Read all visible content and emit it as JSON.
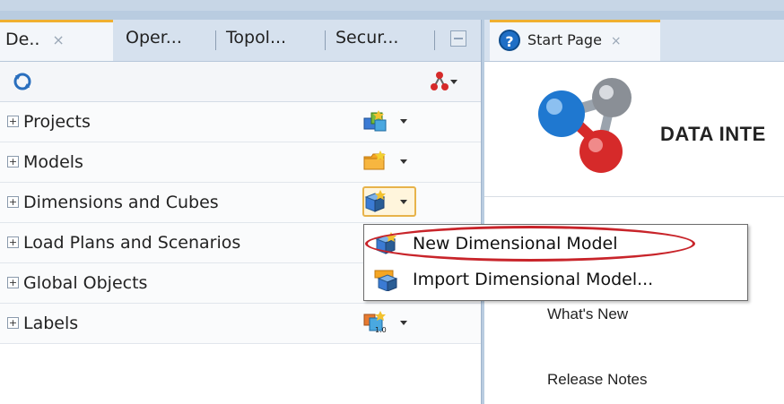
{
  "left_tabs": [
    {
      "label": "De..",
      "close": "×"
    },
    {
      "label": "Oper..."
    },
    {
      "label": "Topol..."
    },
    {
      "label": "Secur..."
    }
  ],
  "tree_rows": [
    {
      "label": "Projects",
      "icon": "projects-icon"
    },
    {
      "label": "Models",
      "icon": "models-folder-icon"
    },
    {
      "label": "Dimensions and Cubes",
      "icon": "dimensional-model-icon"
    },
    {
      "label": "Load Plans and Scenarios",
      "icon": "load-plans-icon"
    },
    {
      "label": "Global Objects",
      "icon": "global-objects-icon"
    },
    {
      "label": "Labels",
      "icon": "labels-icon"
    }
  ],
  "expander_symbol": "+",
  "menu": {
    "items": [
      {
        "label": "New Dimensional Model"
      },
      {
        "label": "Import Dimensional Model..."
      }
    ]
  },
  "start_page": {
    "tab_label": "Start Page",
    "tab_close": "×",
    "help_glyph": "?",
    "brand": "DATA INTE",
    "links": [
      "What's New",
      "Release Notes"
    ]
  },
  "colors": {
    "accent_tab": "#f0b030",
    "highlight_ellipse": "#c8242a",
    "logo_blue": "#1f78d0",
    "logo_red": "#d62a2a",
    "logo_gray": "#8a8f96"
  }
}
